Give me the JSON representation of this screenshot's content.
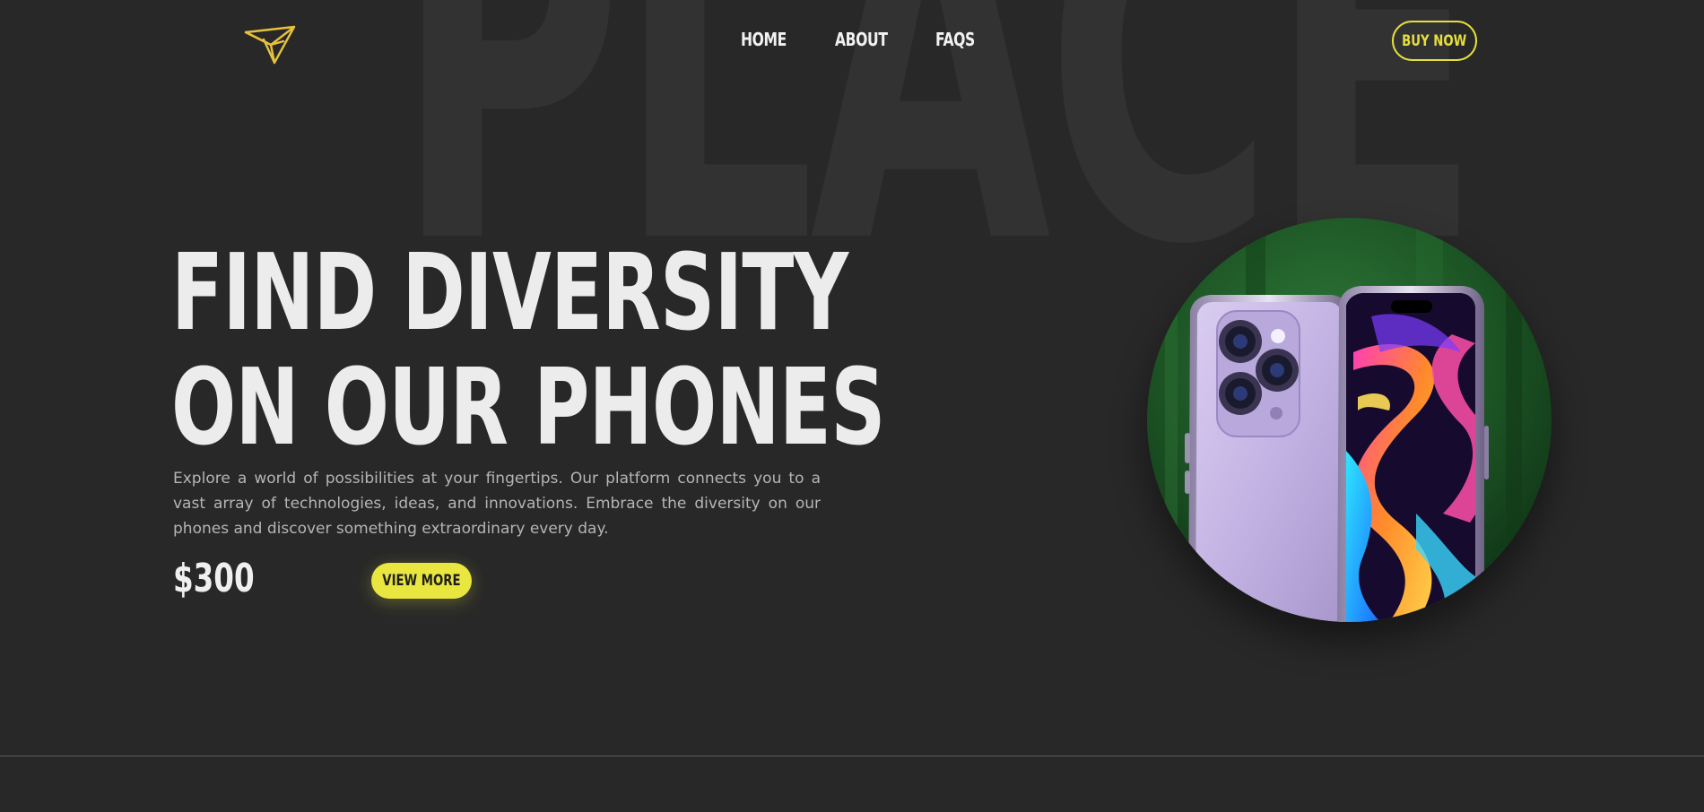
{
  "background": {
    "word": "PLACE",
    "color": "#282828",
    "word_color": "#323232"
  },
  "brand": {
    "logo_icon": "origami-bird-logo-icon",
    "logo_color": "#e6c23c"
  },
  "nav": {
    "items": [
      {
        "label": "HOME"
      },
      {
        "label": "ABOUT"
      },
      {
        "label": "FAQS"
      }
    ],
    "cta_label": "BUY NOW"
  },
  "hero": {
    "title_line1": "FIND DIVERSITY",
    "title_line2": "ON OUR PHONES",
    "description": "Explore a world of possibilities at your fingertips. Our platform connects you to a vast array of technologies, ideas, and innovations. Embrace the diversity on our phones and discover something extraordinary every day.",
    "price": "$300",
    "cta_label": "VIEW MORE"
  },
  "product": {
    "image_icon": "purple-smartphone-image",
    "accent_color": "#e9e63f"
  }
}
